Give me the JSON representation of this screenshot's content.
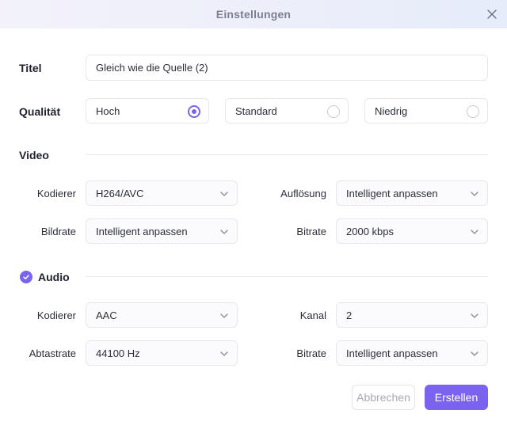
{
  "window": {
    "title": "Einstellungen"
  },
  "titel": {
    "label": "Titel",
    "value": "Gleich wie die Quelle (2)"
  },
  "qualitaet": {
    "label": "Qualität",
    "options": [
      {
        "label": "Hoch",
        "selected": true
      },
      {
        "label": "Standard",
        "selected": false
      },
      {
        "label": "Niedrig",
        "selected": false
      }
    ]
  },
  "video": {
    "label": "Video",
    "kodierer": {
      "label": "Kodierer",
      "value": "H264/AVC"
    },
    "aufloesung": {
      "label": "Auflösung",
      "value": "Intelligent anpassen"
    },
    "bildrate": {
      "label": "Bildrate",
      "value": "Intelligent anpassen"
    },
    "bitrate": {
      "label": "Bitrate",
      "value": "2000 kbps"
    }
  },
  "audio": {
    "label": "Audio",
    "enabled": true,
    "kodierer": {
      "label": "Kodierer",
      "value": "AAC"
    },
    "kanal": {
      "label": "Kanal",
      "value": "2"
    },
    "abtastrate": {
      "label": "Abtastrate",
      "value": "44100 Hz"
    },
    "bitrate": {
      "label": "Bitrate",
      "value": "Intelligent anpassen"
    }
  },
  "footer": {
    "cancel_label": "Abbrechen",
    "create_label": "Erstellen"
  },
  "colors": {
    "accent": "#7b63f0",
    "titlebar": "#eeeff9",
    "border": "#e6e6ec"
  }
}
